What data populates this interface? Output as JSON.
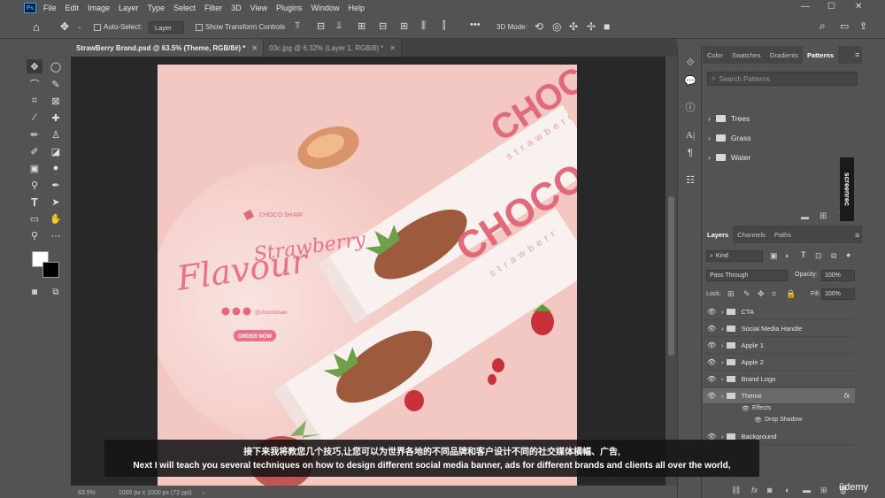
{
  "menubar": {
    "logo": "Ps",
    "items": [
      "File",
      "Edit",
      "Image",
      "Layer",
      "Type",
      "Select",
      "Filter",
      "3D",
      "View",
      "Plugins",
      "Window",
      "Help"
    ]
  },
  "options": {
    "auto_select": "Auto-Select:",
    "layer_dropdown": "Layer",
    "show_transform": "Show Transform Controls",
    "mode_3d": "3D Mode:"
  },
  "tabs": [
    {
      "label": "StrawBerry Brand.psd @ 63.5% (Theme, RGB/8#) *"
    },
    {
      "label": "03c.jpg @ 6.32% (Layer 1, RGB/8) *"
    }
  ],
  "status": {
    "zoom": "63.5%",
    "doc_size": "1000 px x 1000 px (72 ppi)"
  },
  "artwork": {
    "bar_brand": "CHOCO",
    "bar_sub": "strawberr",
    "logo_text": "CHOCO SHAW",
    "script_top": "Strawberry",
    "script_main": "Flavour",
    "handle": "@chocoshaw",
    "cta": "ORDER NOW"
  },
  "patterns_panel": {
    "tabs": [
      "Color",
      "Swatches",
      "Gradients",
      "Patterns"
    ],
    "search_placeholder": "Search Patterns",
    "groups": [
      "Trees",
      "Grass",
      "Water"
    ]
  },
  "layers_panel": {
    "tabs": [
      "Layers",
      "Channels",
      "Paths"
    ],
    "filter": "Kind",
    "blend": "Pass Through",
    "opacity_label": "Opacity:",
    "opacity": "100%",
    "lock_label": "Lock:",
    "fill_label": "Fill:",
    "fill": "100%",
    "layers": [
      "CTA",
      "Social Media Handle",
      "Apple 1",
      "Apple 2",
      "Brand Logo",
      "Theme",
      "Background"
    ],
    "effects_label": "Effects",
    "effect": "Drop Shadow",
    "fx": "fx"
  },
  "subtitle": {
    "cn": "接下来我将教您几个技巧,让您可以为世界各地的不同品牌和客户设计不同的社交媒体横幅、广告,",
    "en": "Next I will teach you several techniques on how to design different social media banner, ads for different brands and clients all over the world,"
  },
  "watermark": {
    "udemy": "ûdemy",
    "screenrec": "screenrec"
  }
}
